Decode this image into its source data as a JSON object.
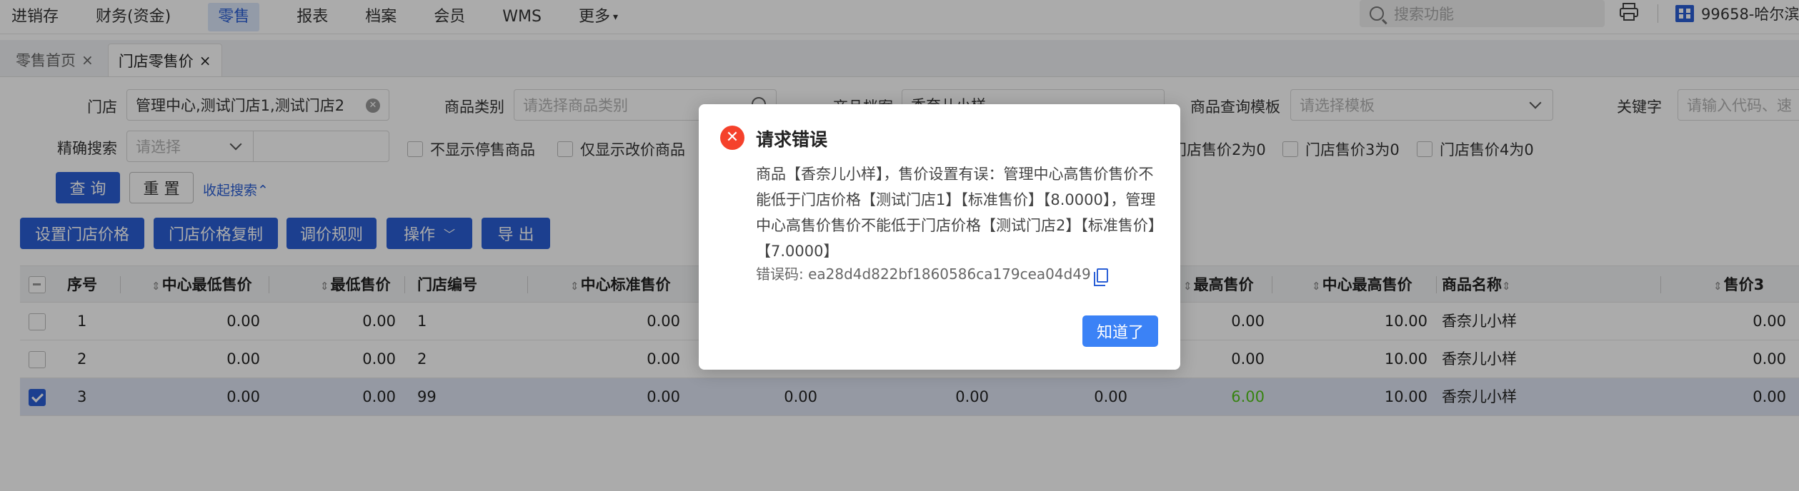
{
  "topnav": {
    "items": [
      "进销存",
      "财务(资金)",
      "零售",
      "报表",
      "档案",
      "会员",
      "WMS",
      "更多"
    ],
    "search_placeholder": "搜索功能",
    "store_label": "99658-哈尔滨"
  },
  "tabs": [
    {
      "label": "零售首页"
    },
    {
      "label": "门店零售价"
    }
  ],
  "filters": {
    "store_label": "门店",
    "store_value": "管理中心,测试门店1,测试门店2",
    "category_label": "商品类别",
    "category_placeholder": "请选择商品类别",
    "archive_label": "商品档案",
    "archive_value": "香奈儿小样",
    "template_label": "商品查询模板",
    "template_placeholder": "请选择模板",
    "keyword_label": "关键字",
    "keyword_placeholder": "请输入代码、速",
    "exact_label": "精确搜索",
    "exact_placeholder": "请选择",
    "cb_hide_stopped": "不显示停售商品",
    "cb_only_changed": "仅显示改价商品",
    "cb_price2": "门店售价2为0",
    "cb_price3": "门店售价3为0",
    "cb_price4": "门店售价4为0"
  },
  "buttons": {
    "query": "查 询",
    "reset": "重 置",
    "collapse": "收起搜索",
    "set_price": "设置门店价格",
    "copy_price": "门店价格复制",
    "adjust_rule": "调价规则",
    "operate": "操作",
    "export": "导 出"
  },
  "table": {
    "headers": [
      "序号",
      "中心最低售价",
      "最低售价",
      "门店编号",
      "中心标准售价",
      "最高售价",
      "中心最高售价",
      "商品名称",
      "售价3"
    ],
    "rows": [
      {
        "seq": "1",
        "center_min": "0.00",
        "min": "0.00",
        "store_no": "1",
        "center_std": "0.00",
        "c1": "",
        "c2": "",
        "c3": "",
        "max": "0.00",
        "center_max": "10.00",
        "name": "香奈儿小样",
        "p3": "0.00",
        "selected": false
      },
      {
        "seq": "2",
        "center_min": "0.00",
        "min": "0.00",
        "store_no": "2",
        "center_std": "0.00",
        "c1": "",
        "c2": "",
        "c3": "",
        "max": "0.00",
        "center_max": "10.00",
        "name": "香奈儿小样",
        "p3": "0.00",
        "selected": false
      },
      {
        "seq": "3",
        "center_min": "0.00",
        "min": "0.00",
        "store_no": "99",
        "center_std": "0.00",
        "c1": "0.00",
        "c2": "0.00",
        "c3": "0.00",
        "max": "6.00",
        "center_max": "10.00",
        "name": "香奈儿小样",
        "p3": "0.00",
        "selected": true
      }
    ]
  },
  "dialog": {
    "title": "请求错误",
    "message": "商品【香奈儿小样】，售价设置有误：管理中心高售价售价不能低于门店价格【测试门店1】【标准售价】【8.0000】，管理中心高售价售价不能低于门店价格【测试门店2】【标准售价】【7.0000】",
    "error_code": "错误码: ea28d4d822bf1860586ca179cea04d49",
    "ok": "知道了"
  },
  "colors": {
    "primary": "#2a5fd6",
    "error": "#f5412b",
    "highlight_value": "#52c41a"
  }
}
